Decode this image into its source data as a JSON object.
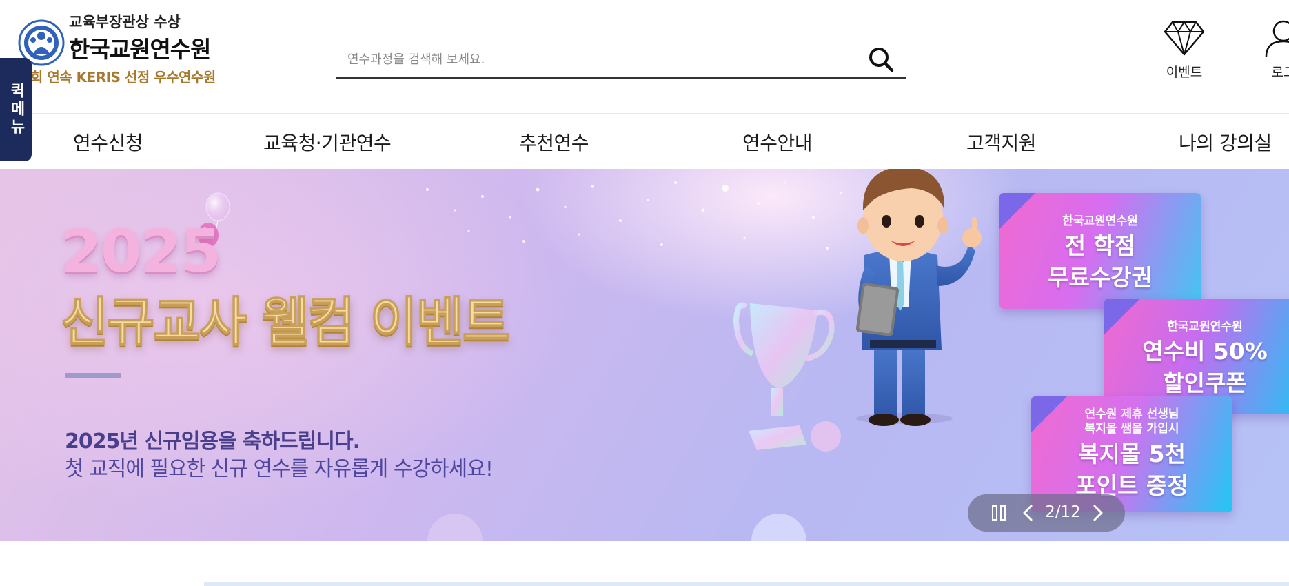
{
  "logo": {
    "award": "교육부장관상 수상",
    "name": "한국교원연수원",
    "slogan": "회 연속 KERIS 선정 우수연수원"
  },
  "search": {
    "placeholder": "연수과정을 검색해 보세요.",
    "icon": "search-icon"
  },
  "utility": [
    {
      "label": "이벤트",
      "icon": "diamond-icon"
    },
    {
      "label": "로그",
      "icon": "user-icon"
    }
  ],
  "quick_menu": {
    "label": "퀵메뉴"
  },
  "gnb": [
    {
      "label": "연수신청"
    },
    {
      "label": "교육청·기관연수"
    },
    {
      "label": "추천연수"
    },
    {
      "label": "연수안내"
    },
    {
      "label": "고객지원"
    },
    {
      "label": "나의 강의실"
    }
  ],
  "banner": {
    "year": "2025",
    "headline": "신규교사 웰컴 이벤트",
    "sub1": "2025년 신규임용을 축하드립니다.",
    "sub2": "첫 교직에 필요한 신규 연수를 자유롭게 수강하세요!",
    "coupons": [
      {
        "small": "한국교원연수원",
        "big1": "전 학점",
        "big2": "무료수강권"
      },
      {
        "small": "한국교원연수원",
        "big1": "연수비 50%",
        "big2": "할인쿠폰"
      },
      {
        "small1": "연수원 제휴 선생님",
        "small2": "복지몰 쌤몰 가입시",
        "big1": "복지몰 5천",
        "big2": "포인트 증정"
      }
    ]
  },
  "slider": {
    "current": "2",
    "separator": "/",
    "total": "12"
  },
  "colors": {
    "quick_menu_bg": "#1d2b5c",
    "slogan": "#a57a2c",
    "headline": "#f6dca0"
  }
}
